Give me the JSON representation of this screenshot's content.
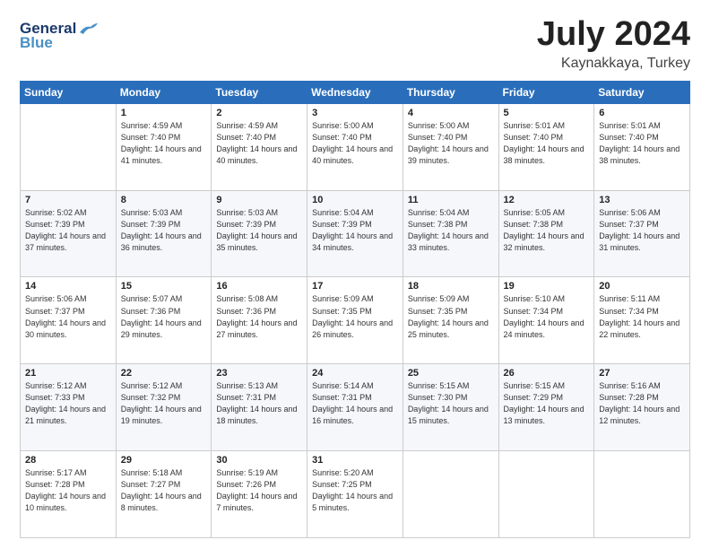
{
  "header": {
    "logo_line1": "General",
    "logo_line2": "Blue",
    "month": "July 2024",
    "location": "Kaynakkaya, Turkey"
  },
  "weekdays": [
    "Sunday",
    "Monday",
    "Tuesday",
    "Wednesday",
    "Thursday",
    "Friday",
    "Saturday"
  ],
  "weeks": [
    [
      {
        "day": "",
        "sunrise": "",
        "sunset": "",
        "daylight": ""
      },
      {
        "day": "1",
        "sunrise": "Sunrise: 4:59 AM",
        "sunset": "Sunset: 7:40 PM",
        "daylight": "Daylight: 14 hours and 41 minutes."
      },
      {
        "day": "2",
        "sunrise": "Sunrise: 4:59 AM",
        "sunset": "Sunset: 7:40 PM",
        "daylight": "Daylight: 14 hours and 40 minutes."
      },
      {
        "day": "3",
        "sunrise": "Sunrise: 5:00 AM",
        "sunset": "Sunset: 7:40 PM",
        "daylight": "Daylight: 14 hours and 40 minutes."
      },
      {
        "day": "4",
        "sunrise": "Sunrise: 5:00 AM",
        "sunset": "Sunset: 7:40 PM",
        "daylight": "Daylight: 14 hours and 39 minutes."
      },
      {
        "day": "5",
        "sunrise": "Sunrise: 5:01 AM",
        "sunset": "Sunset: 7:40 PM",
        "daylight": "Daylight: 14 hours and 38 minutes."
      },
      {
        "day": "6",
        "sunrise": "Sunrise: 5:01 AM",
        "sunset": "Sunset: 7:40 PM",
        "daylight": "Daylight: 14 hours and 38 minutes."
      }
    ],
    [
      {
        "day": "7",
        "sunrise": "Sunrise: 5:02 AM",
        "sunset": "Sunset: 7:39 PM",
        "daylight": "Daylight: 14 hours and 37 minutes."
      },
      {
        "day": "8",
        "sunrise": "Sunrise: 5:03 AM",
        "sunset": "Sunset: 7:39 PM",
        "daylight": "Daylight: 14 hours and 36 minutes."
      },
      {
        "day": "9",
        "sunrise": "Sunrise: 5:03 AM",
        "sunset": "Sunset: 7:39 PM",
        "daylight": "Daylight: 14 hours and 35 minutes."
      },
      {
        "day": "10",
        "sunrise": "Sunrise: 5:04 AM",
        "sunset": "Sunset: 7:39 PM",
        "daylight": "Daylight: 14 hours and 34 minutes."
      },
      {
        "day": "11",
        "sunrise": "Sunrise: 5:04 AM",
        "sunset": "Sunset: 7:38 PM",
        "daylight": "Daylight: 14 hours and 33 minutes."
      },
      {
        "day": "12",
        "sunrise": "Sunrise: 5:05 AM",
        "sunset": "Sunset: 7:38 PM",
        "daylight": "Daylight: 14 hours and 32 minutes."
      },
      {
        "day": "13",
        "sunrise": "Sunrise: 5:06 AM",
        "sunset": "Sunset: 7:37 PM",
        "daylight": "Daylight: 14 hours and 31 minutes."
      }
    ],
    [
      {
        "day": "14",
        "sunrise": "Sunrise: 5:06 AM",
        "sunset": "Sunset: 7:37 PM",
        "daylight": "Daylight: 14 hours and 30 minutes."
      },
      {
        "day": "15",
        "sunrise": "Sunrise: 5:07 AM",
        "sunset": "Sunset: 7:36 PM",
        "daylight": "Daylight: 14 hours and 29 minutes."
      },
      {
        "day": "16",
        "sunrise": "Sunrise: 5:08 AM",
        "sunset": "Sunset: 7:36 PM",
        "daylight": "Daylight: 14 hours and 27 minutes."
      },
      {
        "day": "17",
        "sunrise": "Sunrise: 5:09 AM",
        "sunset": "Sunset: 7:35 PM",
        "daylight": "Daylight: 14 hours and 26 minutes."
      },
      {
        "day": "18",
        "sunrise": "Sunrise: 5:09 AM",
        "sunset": "Sunset: 7:35 PM",
        "daylight": "Daylight: 14 hours and 25 minutes."
      },
      {
        "day": "19",
        "sunrise": "Sunrise: 5:10 AM",
        "sunset": "Sunset: 7:34 PM",
        "daylight": "Daylight: 14 hours and 24 minutes."
      },
      {
        "day": "20",
        "sunrise": "Sunrise: 5:11 AM",
        "sunset": "Sunset: 7:34 PM",
        "daylight": "Daylight: 14 hours and 22 minutes."
      }
    ],
    [
      {
        "day": "21",
        "sunrise": "Sunrise: 5:12 AM",
        "sunset": "Sunset: 7:33 PM",
        "daylight": "Daylight: 14 hours and 21 minutes."
      },
      {
        "day": "22",
        "sunrise": "Sunrise: 5:12 AM",
        "sunset": "Sunset: 7:32 PM",
        "daylight": "Daylight: 14 hours and 19 minutes."
      },
      {
        "day": "23",
        "sunrise": "Sunrise: 5:13 AM",
        "sunset": "Sunset: 7:31 PM",
        "daylight": "Daylight: 14 hours and 18 minutes."
      },
      {
        "day": "24",
        "sunrise": "Sunrise: 5:14 AM",
        "sunset": "Sunset: 7:31 PM",
        "daylight": "Daylight: 14 hours and 16 minutes."
      },
      {
        "day": "25",
        "sunrise": "Sunrise: 5:15 AM",
        "sunset": "Sunset: 7:30 PM",
        "daylight": "Daylight: 14 hours and 15 minutes."
      },
      {
        "day": "26",
        "sunrise": "Sunrise: 5:15 AM",
        "sunset": "Sunset: 7:29 PM",
        "daylight": "Daylight: 14 hours and 13 minutes."
      },
      {
        "day": "27",
        "sunrise": "Sunrise: 5:16 AM",
        "sunset": "Sunset: 7:28 PM",
        "daylight": "Daylight: 14 hours and 12 minutes."
      }
    ],
    [
      {
        "day": "28",
        "sunrise": "Sunrise: 5:17 AM",
        "sunset": "Sunset: 7:28 PM",
        "daylight": "Daylight: 14 hours and 10 minutes."
      },
      {
        "day": "29",
        "sunrise": "Sunrise: 5:18 AM",
        "sunset": "Sunset: 7:27 PM",
        "daylight": "Daylight: 14 hours and 8 minutes."
      },
      {
        "day": "30",
        "sunrise": "Sunrise: 5:19 AM",
        "sunset": "Sunset: 7:26 PM",
        "daylight": "Daylight: 14 hours and 7 minutes."
      },
      {
        "day": "31",
        "sunrise": "Sunrise: 5:20 AM",
        "sunset": "Sunset: 7:25 PM",
        "daylight": "Daylight: 14 hours and 5 minutes."
      },
      {
        "day": "",
        "sunrise": "",
        "sunset": "",
        "daylight": ""
      },
      {
        "day": "",
        "sunrise": "",
        "sunset": "",
        "daylight": ""
      },
      {
        "day": "",
        "sunrise": "",
        "sunset": "",
        "daylight": ""
      }
    ]
  ]
}
